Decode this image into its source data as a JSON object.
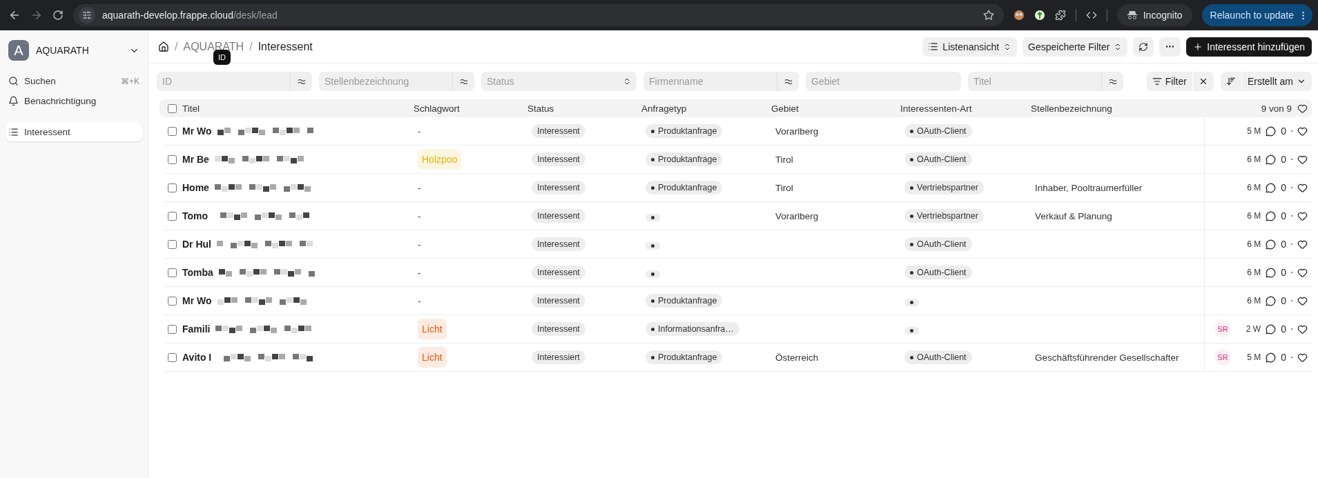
{
  "browser": {
    "url_host": "aquarath-develop.frappe.cloud",
    "url_path": "/desk/lead",
    "incognito": "Incognito",
    "relaunch": "Relaunch to update"
  },
  "sidebar": {
    "workspace": {
      "initial": "A",
      "name": "AQUARATH"
    },
    "search": {
      "label": "Suchen",
      "shortcut": "⌘+K"
    },
    "notifications": "Benachrichtigung",
    "items": [
      {
        "label": "Interessent",
        "selected": true
      }
    ]
  },
  "header": {
    "breadcrumb": {
      "separator": "/",
      "items": [
        "AQUARATH",
        "Interessent"
      ]
    },
    "view_button": "Listenansicht",
    "saved_filters": "Gespeicherte Filter",
    "add_button": "Interessent hinzufügen"
  },
  "tooltip": "ID",
  "filters": [
    {
      "kind": "text",
      "placeholder": "ID"
    },
    {
      "kind": "text",
      "placeholder": "Stellenbezeichnung"
    },
    {
      "kind": "select",
      "placeholder": "Status"
    },
    {
      "kind": "text",
      "placeholder": "Firmenname"
    },
    {
      "kind": "plain",
      "placeholder": "Gebiet"
    },
    {
      "kind": "text",
      "placeholder": "Titel"
    }
  ],
  "filter_button": "Filter",
  "sort_button": "Erstellt am",
  "table": {
    "all_checked": false,
    "columns": [
      "Titel",
      "Schlagwort",
      "Status",
      "Anfragetyp",
      "Gebiet",
      "Interessenten-Art",
      "Stellenbezeichnung"
    ],
    "count": "9 von 9",
    "rows": [
      {
        "checked": false,
        "title": "Mr Wo",
        "tag": "-",
        "status": "Interessent",
        "inquiry": "Produktanfrage",
        "region": "Vorarlberg",
        "type": "OAuth-Client",
        "job": "",
        "avatar": "",
        "age": "5 M",
        "comments": "0"
      },
      {
        "checked": false,
        "title": "Mr Be",
        "tag": {
          "text": "Holzpoo",
          "color": "#eab308"
        },
        "status": "Interessent",
        "inquiry": "Produktanfrage",
        "region": "Tirol",
        "type": "OAuth-Client",
        "job": "",
        "avatar": "",
        "age": "6 M",
        "comments": "0"
      },
      {
        "checked": false,
        "title": "Home",
        "tag": "-",
        "status": "Interessent",
        "inquiry": "Produktanfrage",
        "region": "Tirol",
        "type": "Vertriebspartner",
        "job": "Inhaber, Pooltraumerfüller",
        "avatar": "",
        "age": "6 M",
        "comments": "0"
      },
      {
        "checked": false,
        "title": "Tomo",
        "tag": "-",
        "status": "Interessent",
        "inquiry": "",
        "region": "Vorarlberg",
        "type": "Vertriebspartner",
        "job": "Verkauf & Planung",
        "avatar": "",
        "age": "6 M",
        "comments": "0"
      },
      {
        "checked": false,
        "title": "Dr Hul",
        "tag": "-",
        "status": "Interessent",
        "inquiry": "",
        "region": "",
        "type": "OAuth-Client",
        "job": "",
        "avatar": "",
        "age": "6 M",
        "comments": "0"
      },
      {
        "checked": false,
        "title": "Tomba",
        "tag": "-",
        "status": "Interessent",
        "inquiry": "",
        "region": "",
        "type": "OAuth-Client",
        "job": "",
        "avatar": "",
        "age": "6 M",
        "comments": "0"
      },
      {
        "checked": false,
        "title": "Mr Wo",
        "tag": "-",
        "status": "Interessent",
        "inquiry": "Produktanfrage",
        "region": "",
        "type": "",
        "job": "",
        "avatar": "",
        "age": "6 M",
        "comments": "0"
      },
      {
        "checked": false,
        "title": "Famili",
        "tag": {
          "text": "Licht",
          "color": "#ea580c"
        },
        "status": "Interessent",
        "inquiry": "Informationsanfra…",
        "region": "",
        "type": "",
        "job": "",
        "avatar": "SR",
        "age": "2 W",
        "comments": "0"
      },
      {
        "checked": false,
        "title": "Avito I",
        "tag": {
          "text": "Licht",
          "color": "#ea580c"
        },
        "status": "Interessiert",
        "inquiry": "Produktanfrage",
        "region": "Österreich",
        "type": "OAuth-Client",
        "job": "Geschäftsführender Gesellschafter",
        "avatar": "SR",
        "age": "5 M",
        "comments": "0"
      }
    ]
  }
}
